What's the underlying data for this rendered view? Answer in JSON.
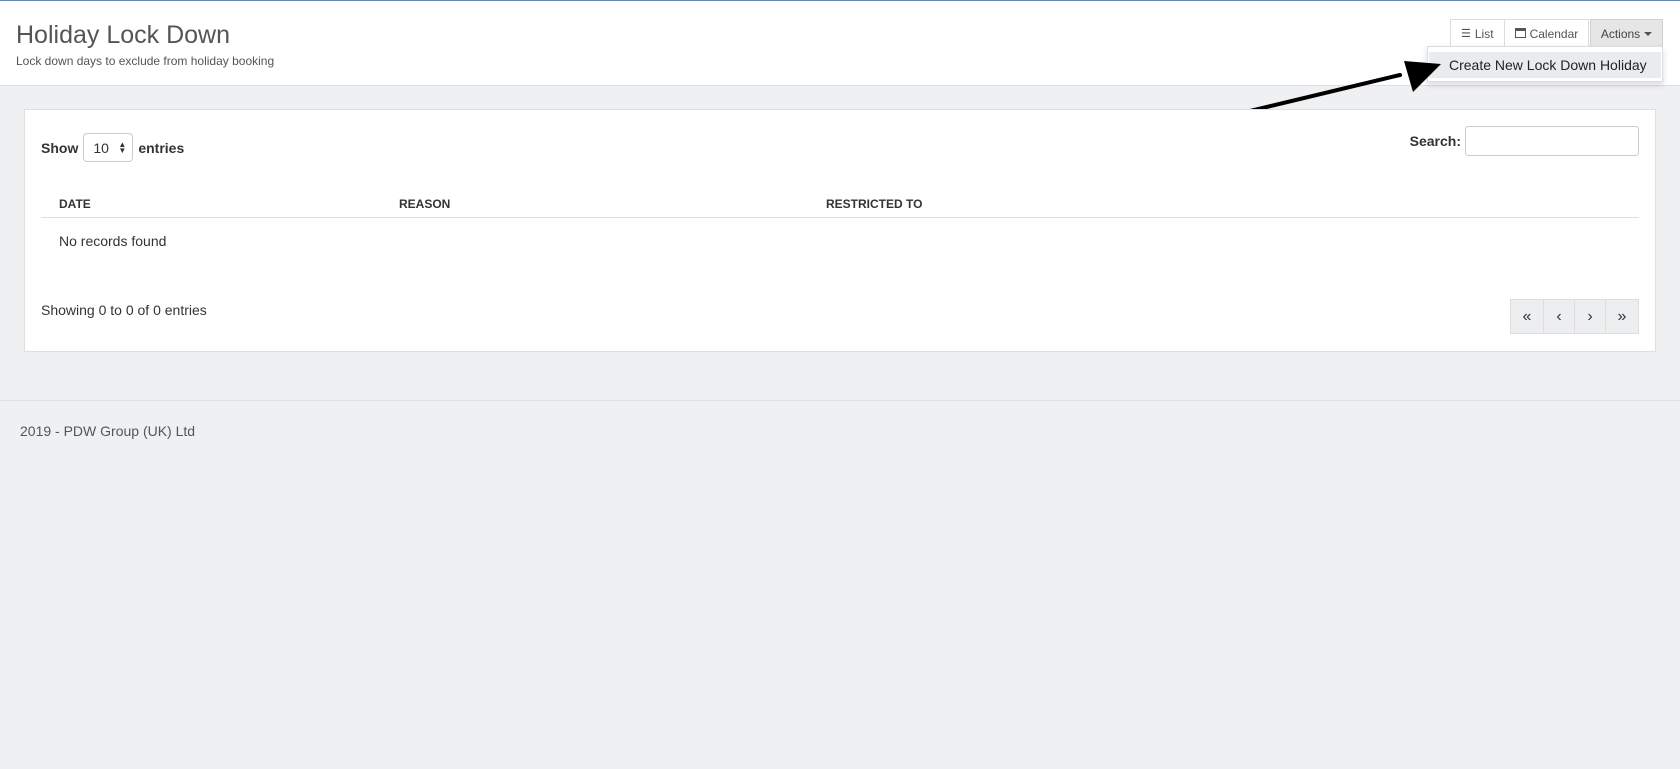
{
  "header": {
    "title": "Holiday Lock Down",
    "subtitle": "Lock down days to exclude from holiday booking",
    "view_buttons": [
      {
        "label": "List",
        "icon": "list-icon"
      },
      {
        "label": "Calendar",
        "icon": "calendar-icon"
      }
    ],
    "actions_label": "Actions",
    "dropdown_items": [
      "Create New Lock Down Holiday"
    ]
  },
  "table": {
    "show_label": "Show",
    "page_size": "10",
    "entries_label": "entries",
    "search_label": "Search:",
    "search_value": "",
    "columns": [
      "DATE",
      "REASON",
      "RESTRICTED TO"
    ],
    "empty_message": "No records found",
    "info": "Showing 0 to 0 of 0 entries",
    "pagination": [
      "«",
      "‹",
      "›",
      "»"
    ]
  },
  "footer": {
    "text": "2019 - PDW Group (UK) Ltd"
  },
  "colors": {
    "accent_line": "#4a90d9",
    "page_background": "#eef0f2",
    "annotation_arrow": "#000000"
  }
}
